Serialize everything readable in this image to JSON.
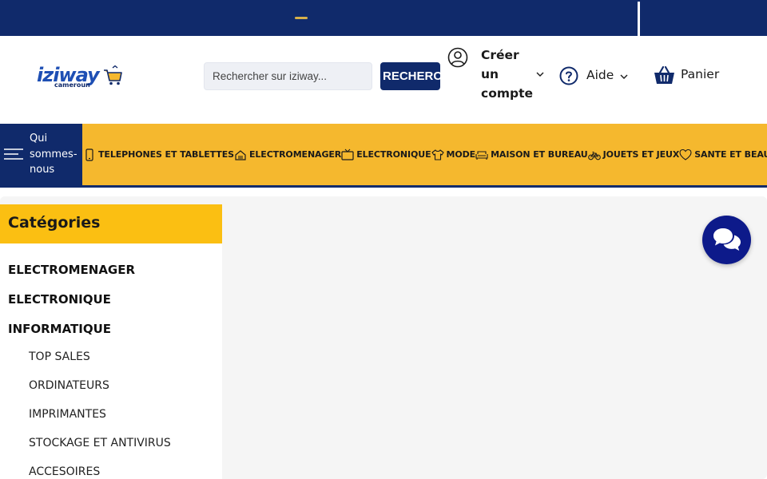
{
  "header": {
    "logo_text": "iziway",
    "logo_sub": "cameroun",
    "search_placeholder": "Rechercher sur iziway...",
    "search_button": "RECHERCHER",
    "account_label": "Créer un compte",
    "help_label": "Aide",
    "cart_label": "Panier"
  },
  "nav": {
    "who_label": "Qui sommes-nous",
    "items": [
      {
        "label": "TELEPHONES ET TABLETTES",
        "icon": "phone-icon"
      },
      {
        "label": "ELECTROMENAGER",
        "icon": "appliance-icon"
      },
      {
        "label": "ELECTRONIQUE",
        "icon": "tv-icon"
      },
      {
        "label": "MODE",
        "icon": "shirt-icon"
      },
      {
        "label": "MAISON ET BUREAU",
        "icon": "sofa-icon"
      },
      {
        "label": "JOUETS ET JEUX",
        "icon": "bike-icon"
      },
      {
        "label": "SANTE ET BEAUTE",
        "icon": "heart-icon"
      }
    ]
  },
  "sidebar": {
    "title": "Catégories",
    "main_categories": [
      "ELECTROMENAGER",
      "ELECTRONIQUE",
      "INFORMATIQUE"
    ],
    "sub_categories": [
      "TOP SALES",
      "ORDINATEURS",
      "IMPRIMANTES",
      "STOCKAGE ET ANTIVIRUS",
      "ACCESOIRES"
    ]
  },
  "colors": {
    "navy": "#102a6b",
    "yellow": "#f5b82e",
    "category_header": "#fbbf12",
    "chat": "#0d1a8a"
  }
}
